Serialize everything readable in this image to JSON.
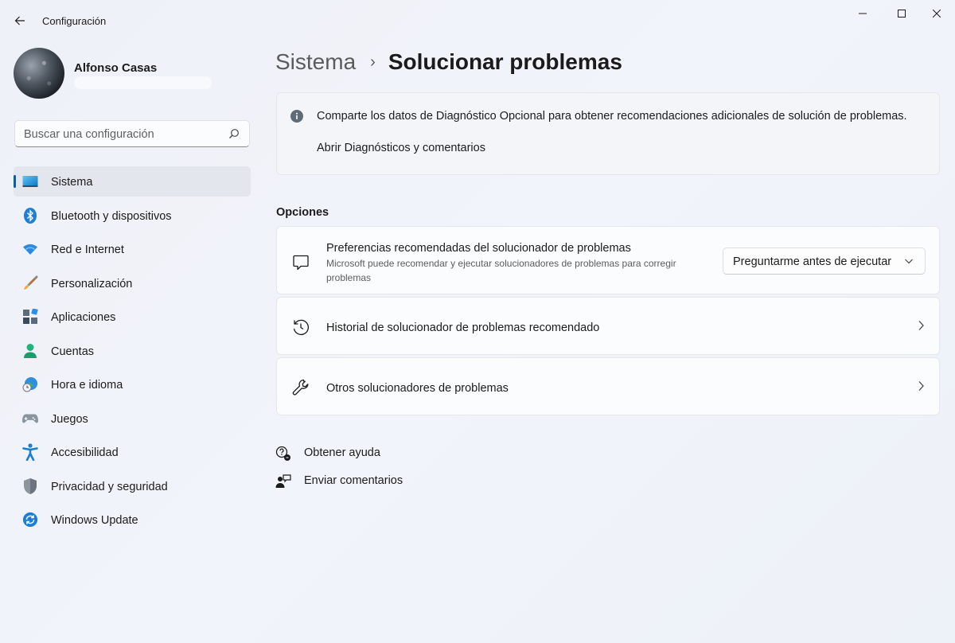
{
  "window": {
    "title": "Configuración"
  },
  "profile": {
    "name": "Alfonso Casas"
  },
  "search": {
    "placeholder": "Buscar una configuración"
  },
  "sidebar": {
    "items": [
      {
        "label": "Sistema",
        "icon": "monitor-icon",
        "active": true
      },
      {
        "label": "Bluetooth y dispositivos",
        "icon": "bluetooth-icon"
      },
      {
        "label": "Red e Internet",
        "icon": "wifi-icon"
      },
      {
        "label": "Personalización",
        "icon": "paintbrush-icon"
      },
      {
        "label": "Aplicaciones",
        "icon": "apps-icon"
      },
      {
        "label": "Cuentas",
        "icon": "person-icon"
      },
      {
        "label": "Hora e idioma",
        "icon": "globe-clock-icon"
      },
      {
        "label": "Juegos",
        "icon": "gamepad-icon"
      },
      {
        "label": "Accesibilidad",
        "icon": "accessibility-icon"
      },
      {
        "label": "Privacidad y seguridad",
        "icon": "shield-icon"
      },
      {
        "label": "Windows Update",
        "icon": "update-icon"
      }
    ]
  },
  "breadcrumb": {
    "parent": "Sistema",
    "separator": "›",
    "current": "Solucionar problemas"
  },
  "info": {
    "text": "Comparte los datos de Diagnóstico Opcional para obtener recomendaciones adicionales de solución de problemas.",
    "link": "Abrir Diagnósticos y comentarios"
  },
  "options": {
    "section_title": "Opciones",
    "preferences": {
      "title": "Preferencias recomendadas del solucionador de problemas",
      "description": "Microsoft puede recomendar y ejecutar solucionadores de problemas para corregir problemas",
      "selected": "Preguntarme antes de ejecutar"
    },
    "history": {
      "title": "Historial de solucionador de problemas recomendado"
    },
    "others": {
      "title": "Otros solucionadores de problemas"
    }
  },
  "help": {
    "get_help": "Obtener ayuda",
    "feedback": "Enviar comentarios"
  },
  "colors": {
    "accent": "#005fb8",
    "background": "#eef2f8"
  }
}
